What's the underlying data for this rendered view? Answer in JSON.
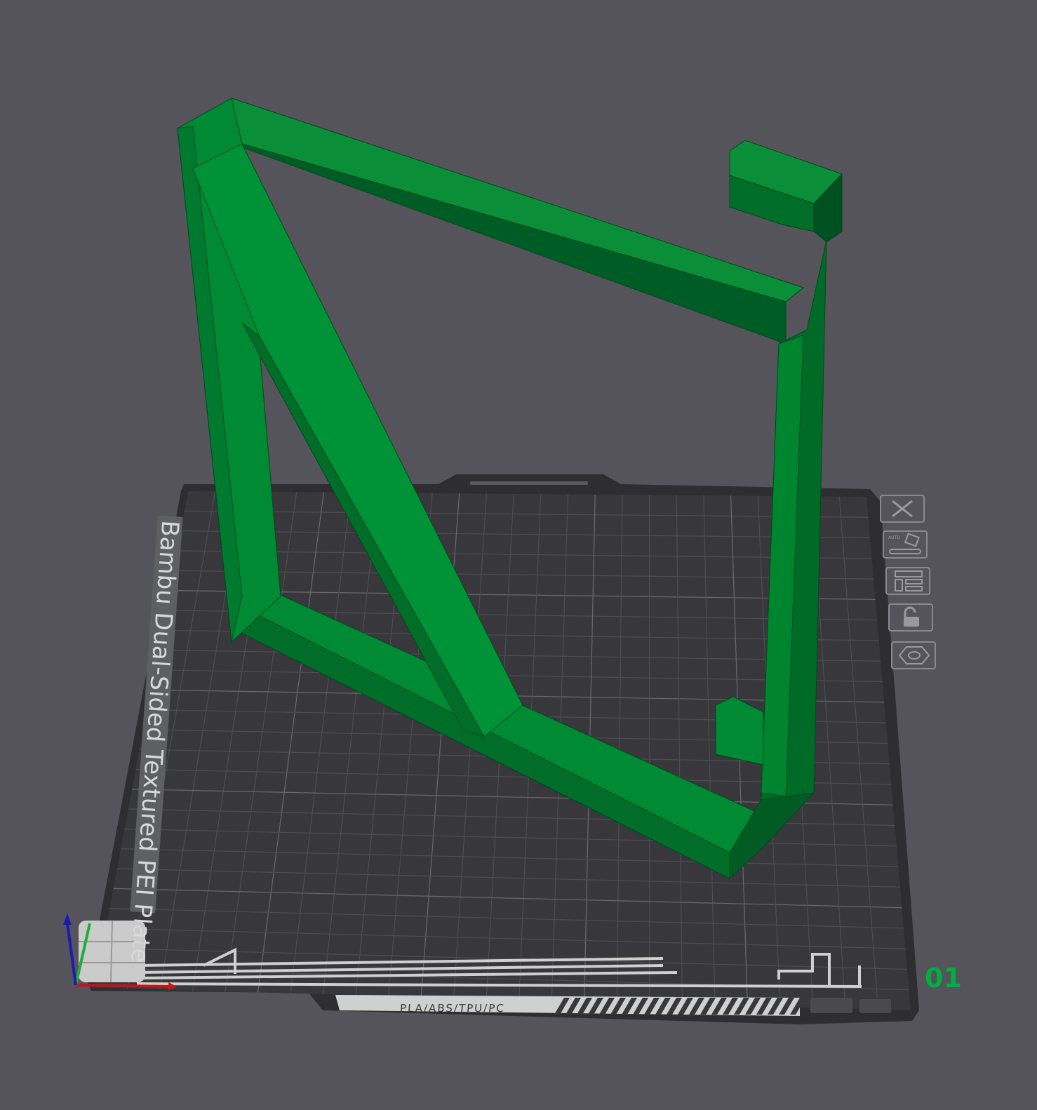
{
  "viewport": {
    "plate_name": "Bambu Dual-Sided Textured PEI Plate",
    "plate_materials": "PLA/ABS/TPU/PC",
    "plate_number": "01",
    "model_color": "#00ae42",
    "background_color": "#55545a"
  },
  "plate_toolbar": [
    {
      "name": "delete-plate",
      "icon": "close-icon"
    },
    {
      "name": "auto-arrange",
      "icon": "auto-orient-icon"
    },
    {
      "name": "arrange",
      "icon": "layout-icon"
    },
    {
      "name": "lock-plate",
      "icon": "unlock-icon"
    },
    {
      "name": "plate-settings",
      "icon": "hex-nut-icon"
    }
  ]
}
